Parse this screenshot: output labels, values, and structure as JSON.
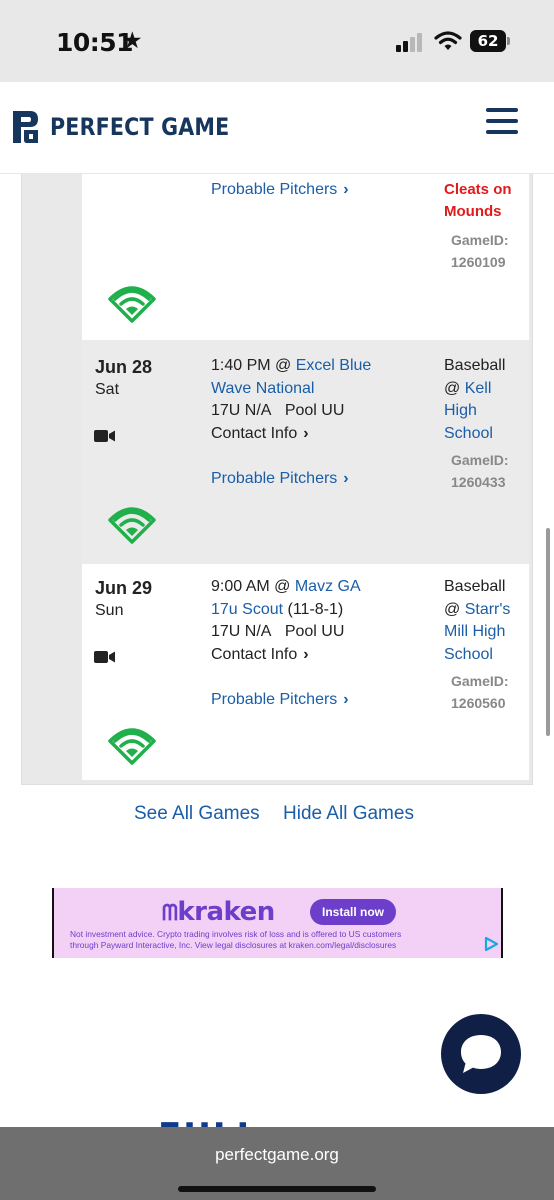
{
  "status_bar": {
    "time": "10:51",
    "battery": "62"
  },
  "header": {
    "brand": "PERFECT GAME"
  },
  "games": [
    {
      "probable_pitchers": "Probable Pitchers",
      "location_lines": [
        "Cleats on",
        "Mounds"
      ],
      "game_id_label": "GameID:",
      "game_id": "1260109"
    },
    {
      "date": "Jun 28",
      "day": "Sat",
      "time_at": "1:40 PM @",
      "opponent_line1": "Excel Blue",
      "opponent_line2": "Wave National",
      "opponent_record": "",
      "division": "17U N/A",
      "pool": "Pool UU",
      "contact": "Contact Info",
      "probable_pitchers": "Probable Pitchers",
      "sport": "Baseball",
      "at": "@",
      "venue_line1": "Kell",
      "venue_line2": "High",
      "venue_line3": "School",
      "game_id_label": "GameID:",
      "game_id": "1260433"
    },
    {
      "date": "Jun 29",
      "day": "Sun",
      "time_at": "9:00 AM @",
      "opponent_line1": "Mavz GA",
      "opponent_line2": "17u Scout",
      "opponent_record": "(11-8-1)",
      "division": "17U N/A",
      "pool": "Pool UU",
      "contact": "Contact Info",
      "probable_pitchers": "Probable Pitchers",
      "sport": "Baseball",
      "at": "@",
      "venue_line1": "Starr's",
      "venue_line2": "Mill High",
      "venue_line3": "School",
      "game_id_label": "GameID:",
      "game_id": "1260560"
    }
  ],
  "links": {
    "see_all": "See All Games",
    "hide_all": "Hide All Games"
  },
  "ad": {
    "brand": "kraken",
    "cta": "Install now",
    "disclaimer_1": "Not investment advice. Crypto trading involves risk of loss and is offered to US customers",
    "disclaimer_2": "through Payward Interactive, Inc. View legal disclosures at kraken.com/legal/disclosures"
  },
  "partial_heading": "FULL ROSTER",
  "browser": {
    "url": "perfectgame.org"
  },
  "colors": {
    "navy": "#16365e",
    "link": "#1a5ea8",
    "alert_red": "#e01b1b",
    "field_green": "#20b04b",
    "ad_purple": "#6d3ec9"
  }
}
